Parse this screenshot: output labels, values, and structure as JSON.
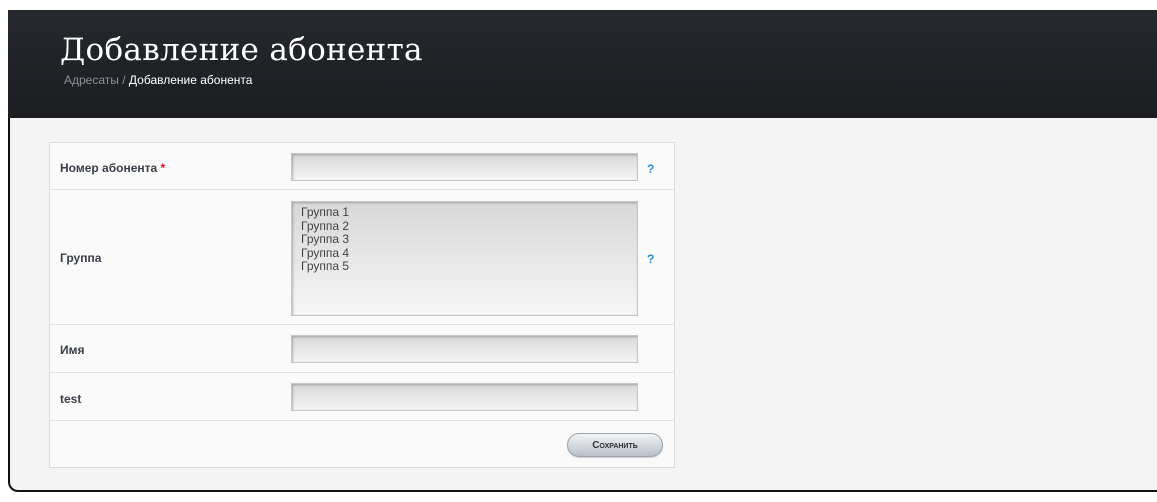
{
  "header": {
    "title": "Добавление абонента",
    "breadcrumb": {
      "link": "Адресаты",
      "separator": " / ",
      "current": "Добавление абонента"
    }
  },
  "form": {
    "fields": {
      "number": {
        "label": "Номер абонента",
        "required_mark": "*",
        "value": "",
        "help": "?"
      },
      "group": {
        "label": "Группа",
        "options": [
          "Группа 1",
          "Группа 2",
          "Группа 3",
          "Группа 4",
          "Группа 5"
        ],
        "help": "?"
      },
      "name": {
        "label": "Имя",
        "value": ""
      },
      "test": {
        "label": "test",
        "value": ""
      }
    },
    "save_label": "Сохранить"
  },
  "colors": {
    "header_bg": "#1f2226",
    "help_icon": "#2a8bd0",
    "required": "#d0102a"
  }
}
